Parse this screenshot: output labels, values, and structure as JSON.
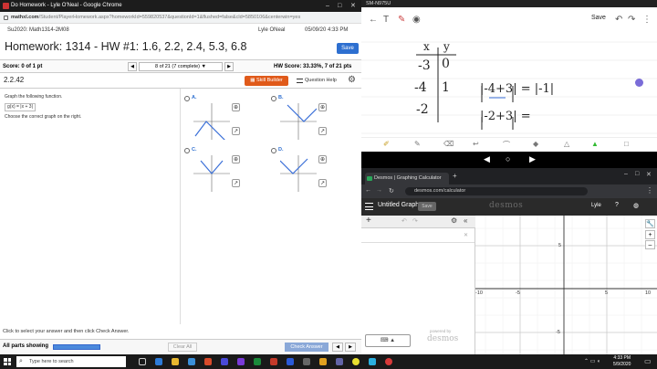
{
  "browser_left": {
    "title": "Do Homework - Lyle O'Neal - Google Chrome",
    "url_host": "mathxl.com",
    "url_path": "/Student/PlayerHomework.aspx?homeworkId=559820537&questionId=1&flushed=false&cld=5850106&centerwin=yes"
  },
  "course": {
    "name": "Su2020: Math1314-2M08",
    "user": "Lyle ONeal",
    "date": "05/09/20 4:33 PM"
  },
  "homework": {
    "title": "Homework: 1314 - HW #1: 1.6, 2.2, 2.4, 5.3, 6.8",
    "save_label": "Save",
    "score_label": "Score: 0 of 1 pt",
    "question_nav": "8 of 21 (7 complete) ▼",
    "hw_score": "HW Score: 33.33%, 7 of 21 pts",
    "question_id": "2.2.42",
    "skill_builder": "Skill Builder",
    "question_help": "Question Help"
  },
  "question": {
    "prompt": "Graph the following function.",
    "function": "g(x) = |x + 3|",
    "instruction": "Choose the correct graph on the right.",
    "options": [
      {
        "letter": "A.",
        "shape": "v-down"
      },
      {
        "letter": "B.",
        "shape": "v-up-right"
      },
      {
        "letter": "C.",
        "shape": "v-up"
      },
      {
        "letter": "D.",
        "shape": "v-up-left"
      }
    ],
    "axis_ticks": [
      "10",
      "-10",
      "10",
      "-10"
    ]
  },
  "footer": {
    "hint": "Click to select your answer and then click Check Answer.",
    "all_parts": "All parts showing",
    "clear_all": "Clear All",
    "check_answer": "Check Answer"
  },
  "phone": {
    "status": "SM-N975U",
    "save_label": "Save",
    "table_header_x": "x",
    "table_header_y": "y",
    "table_x": [
      "-3",
      "-4",
      "-2"
    ],
    "table_y": [
      "0",
      "1",
      ""
    ],
    "work_line1": "|-4+3| = |-1|",
    "work_line2": "|-2+3| ="
  },
  "desmos": {
    "tab_title": "Desmos | Graphing Calculator",
    "url": "desmos.com/calculator",
    "graph_title": "Untitled Graph",
    "save_label": "Save",
    "logo": "desmos",
    "user": "Lyle",
    "powered_by": "powered by",
    "powered_logo": "desmos",
    "x_ticks": [
      "-10",
      "-5",
      "5",
      "10"
    ],
    "y_ticks": [
      "5",
      "-5"
    ]
  },
  "taskbar": {
    "search_placeholder": "Type here to search",
    "time": "4:33 PM",
    "date": "5/9/2020"
  },
  "colors": {
    "accent_blue": "#2d6fd0",
    "skill_orange": "#e05a1a",
    "desmos_green": "#2aa65a"
  }
}
